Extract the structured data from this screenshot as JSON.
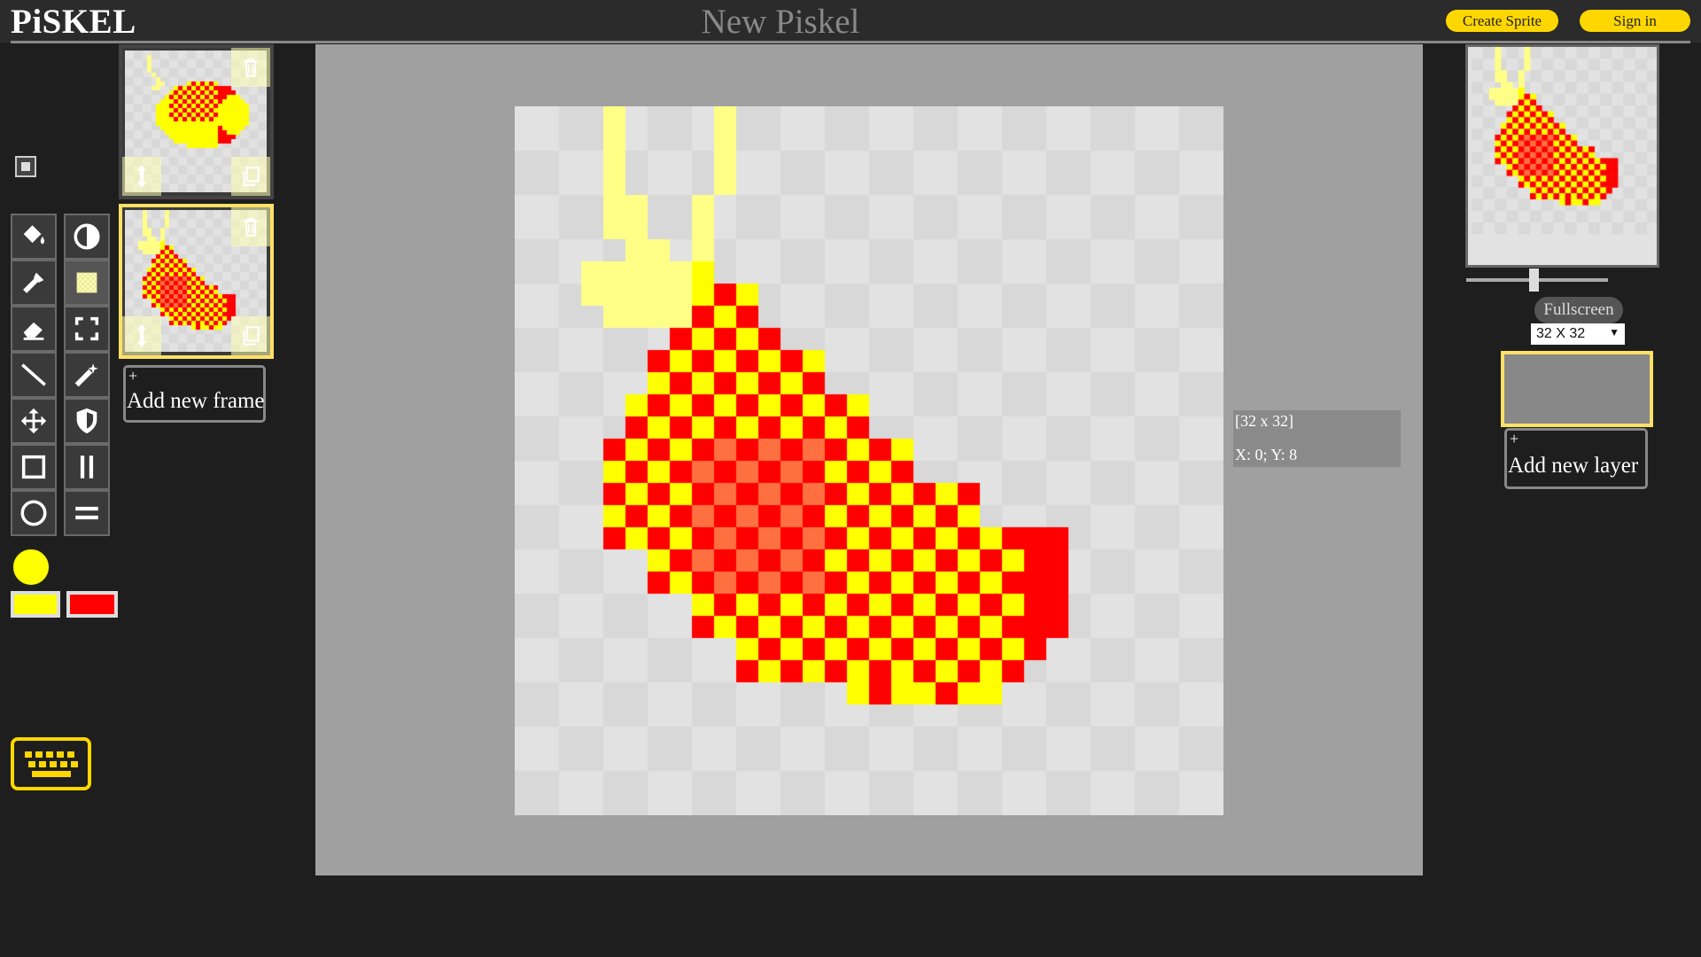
{
  "app": {
    "logo": "PiSKEL",
    "title": "New Piskel"
  },
  "header": {
    "create_sprite": "Create Sprite",
    "sign_in": "Sign in"
  },
  "tools": [
    {
      "name": "paint-bucket-tool-icon"
    },
    {
      "name": "lighten-tool-icon"
    },
    {
      "name": "eyedropper-tool-icon"
    },
    {
      "name": "dithering-tool-icon",
      "selected": true
    },
    {
      "name": "eraser-tool-icon"
    },
    {
      "name": "rectangle-select-tool-icon"
    },
    {
      "name": "line-tool-icon"
    },
    {
      "name": "magic-wand-tool-icon"
    },
    {
      "name": "move-tool-icon"
    },
    {
      "name": "shape-select-tool-icon"
    },
    {
      "name": "rectangle-tool-icon"
    },
    {
      "name": "vertical-mirror-pen-icon"
    },
    {
      "name": "circle-tool-icon"
    },
    {
      "name": "horizontal-mirror-pen-icon"
    }
  ],
  "colors": {
    "primary": "#ffff00",
    "secondary": "#ff0000",
    "accent": "#ffd700"
  },
  "frames": {
    "add_label": "Add new frame",
    "plus": "+",
    "count": 2,
    "active_index": 1
  },
  "canvas": {
    "size_label": "[32 x 32]",
    "coords_label": "X: 0; Y: 8",
    "width": 32,
    "height": 32
  },
  "preview": {
    "fullscreen_label": "Fullscreen",
    "size_option": "32 X 32",
    "fps_fraction": 0.45
  },
  "layers": {
    "add_label": "Add new layer",
    "plus": "+"
  }
}
